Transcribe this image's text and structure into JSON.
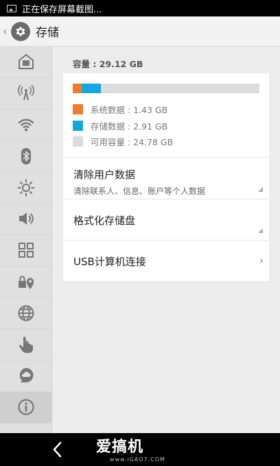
{
  "status_bar": {
    "text": "正在保存屏幕截图..."
  },
  "action_bar": {
    "title": "存储"
  },
  "sidebar": {
    "items": [
      {
        "icon": "home-icon"
      },
      {
        "icon": "antenna-icon"
      },
      {
        "icon": "wifi-icon"
      },
      {
        "icon": "bluetooth-icon"
      },
      {
        "icon": "brightness-icon"
      },
      {
        "icon": "volume-icon"
      },
      {
        "icon": "apps-grid-icon"
      },
      {
        "icon": "lock-location-icon"
      },
      {
        "icon": "globe-icon"
      },
      {
        "icon": "hand-pointer-icon"
      },
      {
        "icon": "cloud-chat-icon"
      },
      {
        "icon": "info-icon",
        "active": true
      }
    ]
  },
  "storage": {
    "capacity_label": "容量 : 29.12 GB",
    "usage": {
      "system_fraction": 0.049,
      "storage_fraction": 0.1
    },
    "legend": [
      {
        "label": "系统数据 : 1.43 GB",
        "color": "#f07c2d"
      },
      {
        "label": "存储数据 : 2.91 GB",
        "color": "#15a8dc"
      },
      {
        "label": "可用容量 : 24.78 GB",
        "color": "#dcdcdc"
      }
    ]
  },
  "menu": {
    "clear_title": "清除用户数据",
    "clear_sub": "清除联系人、信息、账户等个人数据",
    "format_title": "格式化存储盘",
    "usb_title": "USB计算机连接"
  },
  "watermark": {
    "name": "爱搞机",
    "url": "www.iGAO7.COM"
  }
}
